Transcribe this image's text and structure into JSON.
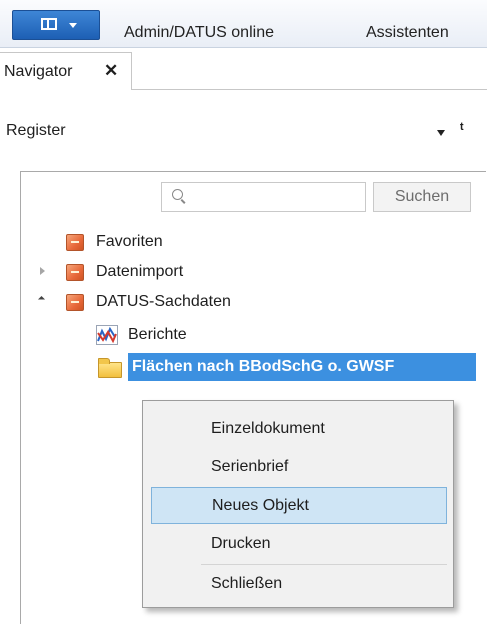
{
  "ribbon": {
    "tabs": [
      "Admin/DATUS online",
      "Assistenten"
    ]
  },
  "panel_tab": {
    "title": "Navigator",
    "close": "✕"
  },
  "pane": {
    "title": "Register",
    "pin": "ᵗ"
  },
  "search": {
    "placeholder": "",
    "button": "Suchen"
  },
  "tree": {
    "items": [
      {
        "label": "Favoriten",
        "expander": "none",
        "icon": "orange-folder-icon"
      },
      {
        "label": "Datenimport",
        "expander": "collapsed",
        "icon": "orange-folder-icon"
      },
      {
        "label": "DATUS-Sachdaten",
        "expander": "expanded",
        "icon": "orange-folder-icon"
      },
      {
        "label": "Berichte",
        "expander": "none",
        "icon": "report-icon"
      },
      {
        "label": "Flächen nach BBodSchG o. GWSF",
        "expander": "none",
        "icon": "yellow-folder-icon",
        "selected": true
      }
    ]
  },
  "context_menu": {
    "items": [
      "Einzeldokument",
      "Serienbrief",
      "Neues Objekt",
      "Drucken",
      "Schließen"
    ],
    "highlighted_index": 2
  },
  "colors": {
    "selection": "#3c90e0",
    "menu_highlight": "#cfe5f5",
    "app_button": "#1d5fb4"
  }
}
